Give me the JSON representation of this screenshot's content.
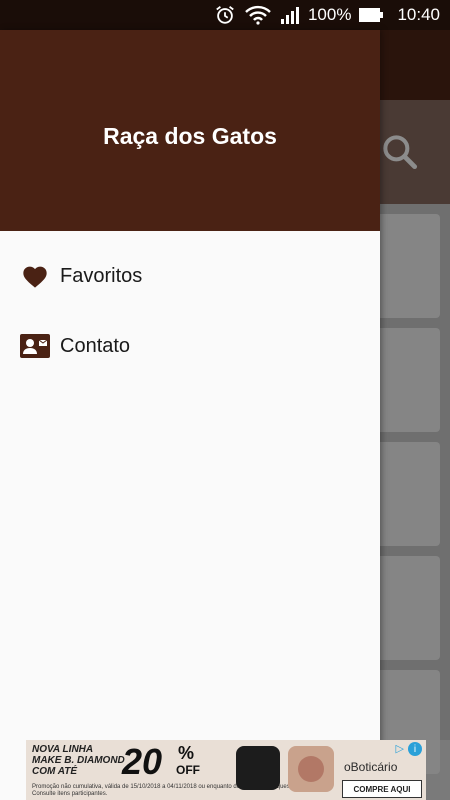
{
  "status_bar": {
    "battery_percent": "100%",
    "time": "10:40",
    "icons": [
      "alarm-icon",
      "wifi-icon",
      "signal-icon",
      "battery-icon"
    ]
  },
  "drawer": {
    "title": "Raça dos Gatos",
    "items": [
      {
        "label": "Favoritos",
        "icon": "heart-icon"
      },
      {
        "label": "Contato",
        "icon": "contact-card-icon"
      }
    ]
  },
  "background": {
    "search_icon": "search-icon"
  },
  "ad": {
    "line1": "NOVA LINHA",
    "line2": "MAKE B. DIAMOND",
    "line3": "COM ATÉ",
    "big_number": "20",
    "percent": "%",
    "off": "OFF",
    "fine_print": "Promoção não cumulativa, válida de 15/10/2018 a 04/11/2018 ou enquanto durarem os estoques. Consulte itens participantes.",
    "brand": "oBoticário",
    "cta": "COMPRE AQUI"
  },
  "colors": {
    "drawer_header": "#4a2214",
    "icon_color": "#4a2214",
    "status_bar": "#1a0d08"
  }
}
